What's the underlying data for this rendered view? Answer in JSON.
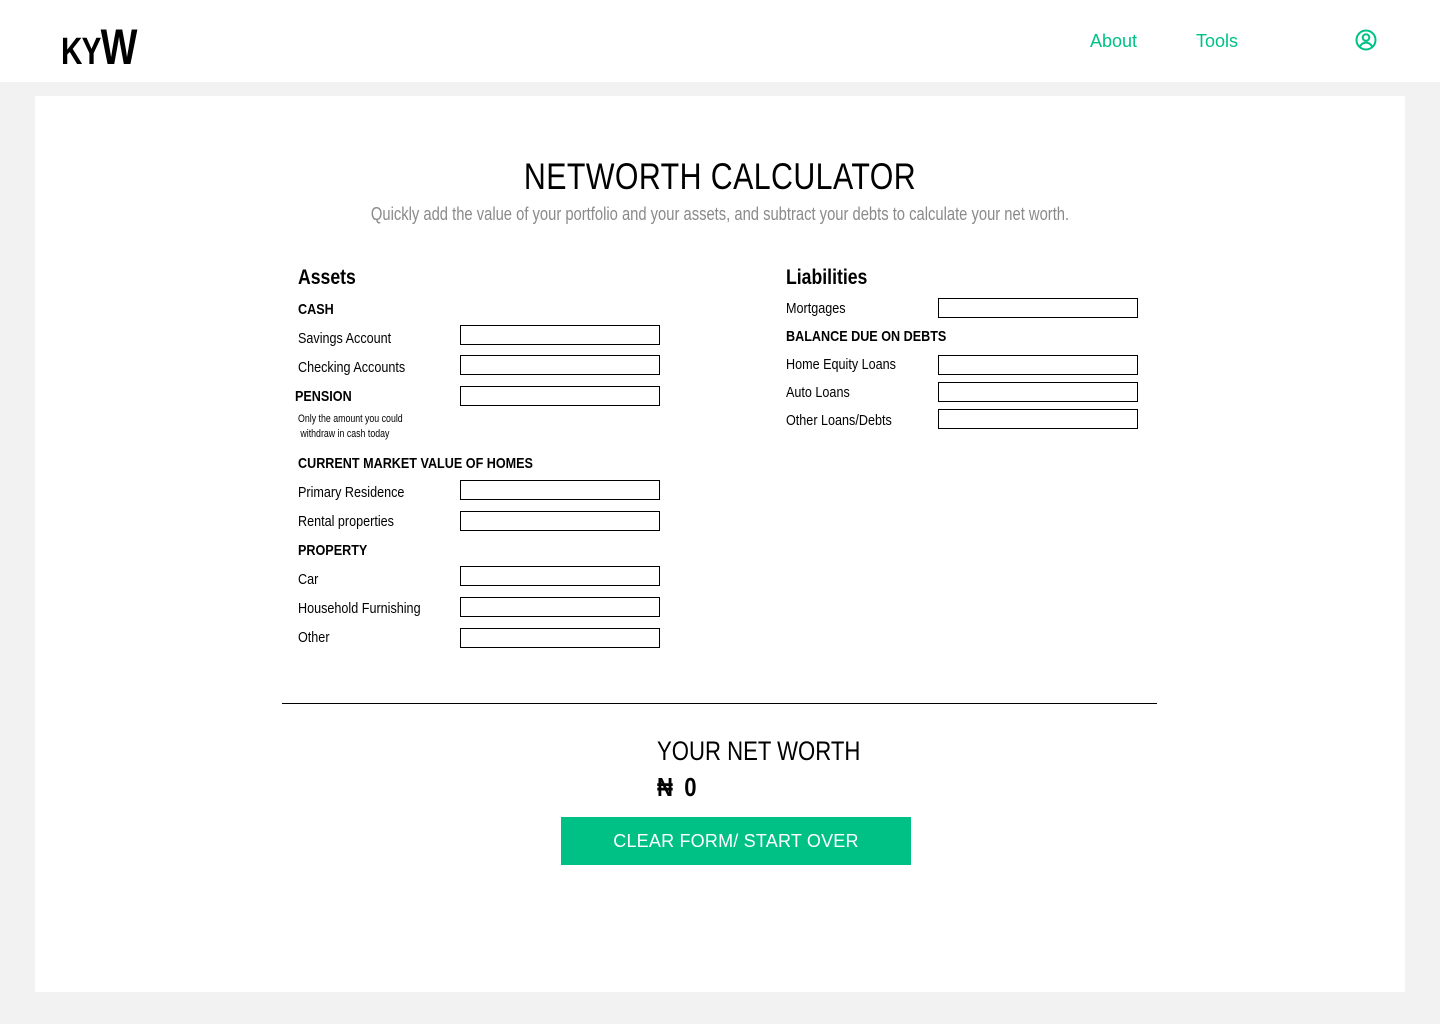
{
  "header": {
    "logo": {
      "k": "K",
      "y": "Y",
      "w": "W"
    },
    "nav": {
      "about": "About",
      "tools": "Tools"
    },
    "user_icon": "user-circle-icon",
    "accent_color": "#00c185"
  },
  "main": {
    "title": "NETWORTH CALCULATOR",
    "subtitle": "Quickly add the value of your portfolio and your assets, and subtract your debts to calculate your net worth.",
    "assets": {
      "heading": "Assets",
      "cash_heading": "CASH",
      "savings": "Savings Account",
      "checking": "Checking Accounts",
      "pension_heading": "PENSION",
      "pension_note_1": "Only the amount you could",
      "pension_note_2": "withdraw in cash today",
      "homes_heading": "CURRENT MARKET VALUE OF HOMES",
      "primary_residence": "Primary Residence",
      "rental": "Rental properties",
      "property_heading": "PROPERTY",
      "car": "Car",
      "furnishing": "Household Furnishing",
      "other": "Other"
    },
    "liabilities": {
      "heading": "Liabilities",
      "mortgages": "Mortgages",
      "debts_heading": "BALANCE DUE ON DEBTS",
      "home_equity": "Home Equity Loans",
      "auto": "Auto Loans",
      "other_loans": "Other Loans/Debts"
    },
    "result": {
      "label": "YOUR NET WORTH",
      "currency": "₦",
      "value": "0"
    },
    "clear_button": "CLEAR FORM/ START OVER"
  }
}
